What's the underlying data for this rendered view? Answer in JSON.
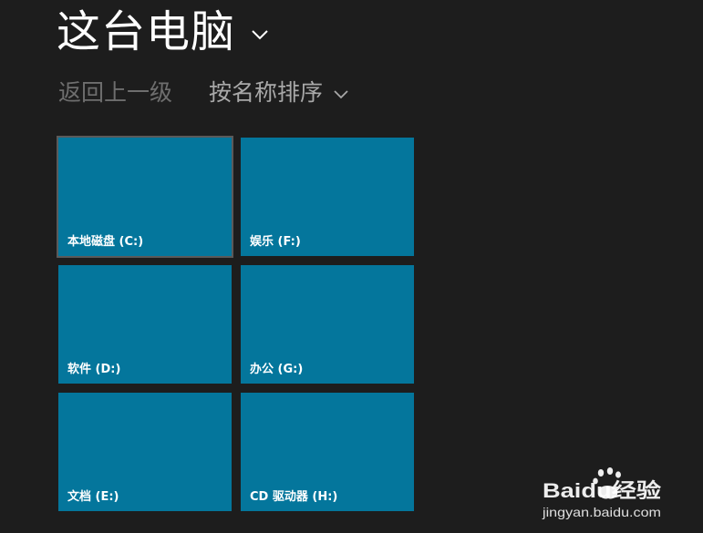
{
  "header": {
    "title": "这台电脑",
    "title_dropdown_icon": "chevron-down-icon"
  },
  "nav": {
    "back_label": "返回上一级",
    "sort_label": "按名称排序",
    "sort_dropdown_icon": "chevron-down-icon"
  },
  "drives": [
    {
      "label": "本地磁盘 (C:)",
      "selected": true
    },
    {
      "label": "娱乐 (F:)",
      "selected": false
    },
    {
      "label": "软件 (D:)",
      "selected": false
    },
    {
      "label": "办公 (G:)",
      "selected": false
    },
    {
      "label": "文档 (E:)",
      "selected": false
    },
    {
      "label": "CD 驱动器 (H:)",
      "selected": false
    }
  ],
  "colors": {
    "background": "#1d1d1d",
    "tile": "#04769c",
    "selected_outline": "#5a5a5a",
    "title_text": "#ffffff",
    "back_text": "#6e6e6e",
    "sort_text": "#a8a8a8"
  },
  "watermark": {
    "brand": "Baidu经验",
    "url": "jingyan.baidu.com"
  }
}
